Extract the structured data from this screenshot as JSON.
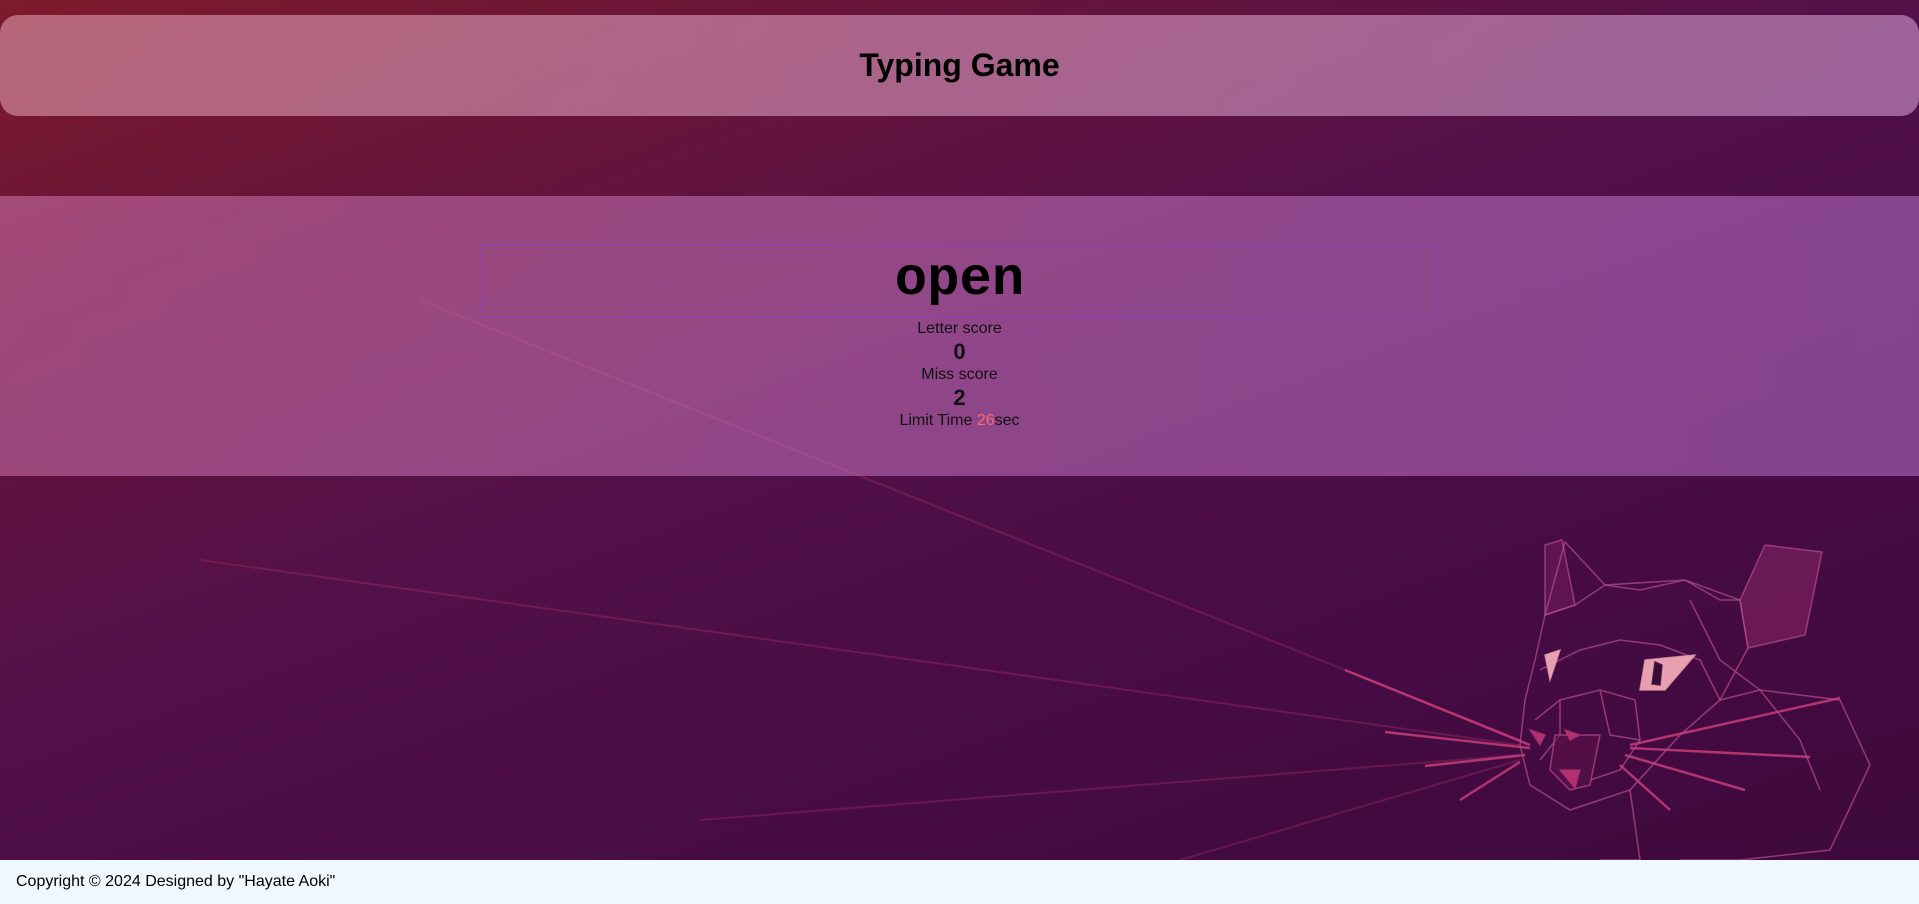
{
  "header": {
    "title": "Typing Game"
  },
  "game": {
    "current_word": "open",
    "letter_score_label": "Letter score",
    "letter_score_value": "0",
    "miss_score_label": "Miss score",
    "miss_score_value": "2",
    "limit_time_label": "Limit Time ",
    "limit_time_value": "26",
    "limit_time_unit": "sec"
  },
  "footer": {
    "copyright": "Copyright © 2024 Designed by \"Hayate Aoki\""
  },
  "colors": {
    "timer_value": "#ff6a6a",
    "footer_bg": "#f0f8ff",
    "word_box_border": "#8a3fb8"
  },
  "background": {
    "wallpaper_icon": "cat-wallpaper-icon"
  }
}
